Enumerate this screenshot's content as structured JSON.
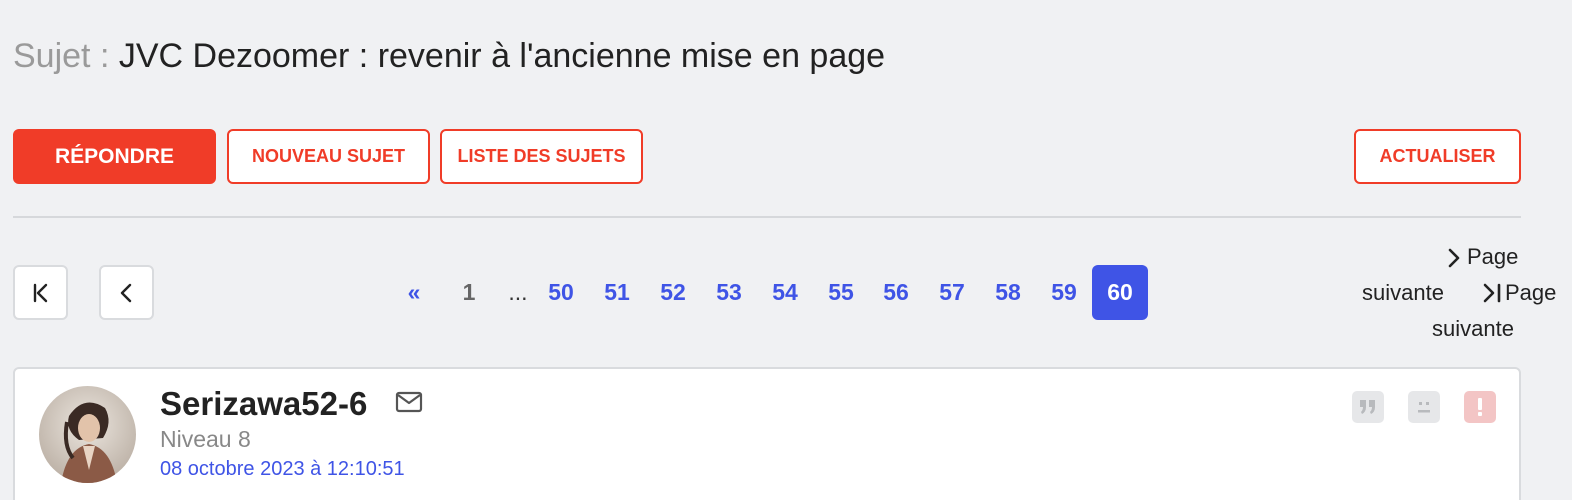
{
  "header": {
    "prefix": "Sujet :",
    "title": "JVC Dezoomer : revenir à l'ancienne mise en page"
  },
  "toolbar": {
    "reply_label": "RÉPONDRE",
    "new_topic_label": "NOUVEAU SUJET",
    "topic_list_label": "LISTE DES SUJETS",
    "refresh_label": "ACTUALISER"
  },
  "pagination": {
    "first_icon": "first-page-icon",
    "prev_icon": "chevron-left-icon",
    "prev_symbol": "«",
    "first_page": "1",
    "ellipsis": "...",
    "pages": [
      "50",
      "51",
      "52",
      "53",
      "54",
      "55",
      "56",
      "57",
      "58",
      "59"
    ],
    "current": "60",
    "next_label_1": "Page",
    "next_label_2": "suivante",
    "last_label_1": "Page",
    "last_label_2": "suivante"
  },
  "post": {
    "author": "Serizawa52-6",
    "level": "Niveau 8",
    "date": "08 octobre 2023 à 12:10:51",
    "icons": [
      "mail-icon",
      "quote-icon",
      "sad-face-icon",
      "alert-icon"
    ]
  },
  "colors": {
    "accent_red": "#f03c28",
    "accent_blue": "#3f54e6",
    "background": "#f0f1f3"
  }
}
